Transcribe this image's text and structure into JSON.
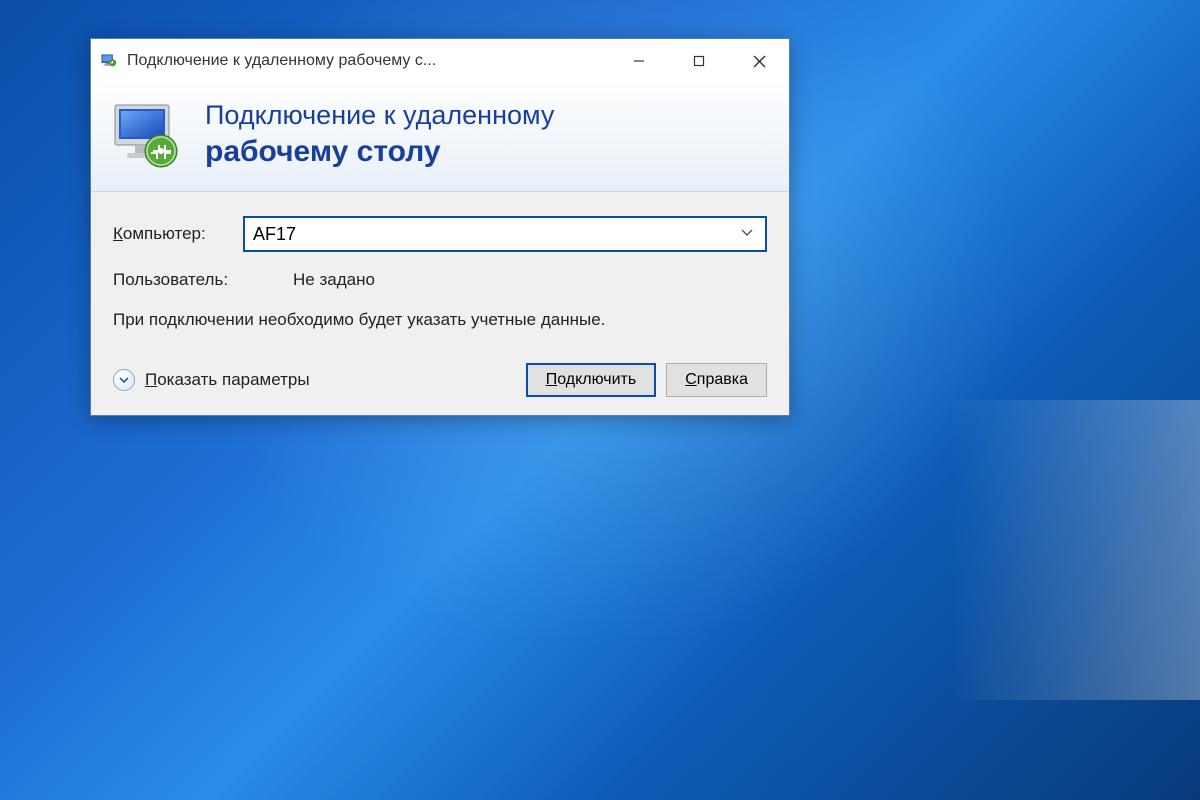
{
  "titlebar": {
    "title": "Подключение к удаленному рабочему с..."
  },
  "header": {
    "line1": "Подключение к удаленному",
    "line2": "рабочему столу"
  },
  "form": {
    "computer_label": "Компьютер:",
    "computer_value": "AF17",
    "user_label": "Пользователь:",
    "user_value": "Не задано",
    "hint": "При подключении необходимо будет указать учетные данные."
  },
  "footer": {
    "show_options": "Показать параметры",
    "connect": "Подключить",
    "help": "Справка"
  }
}
